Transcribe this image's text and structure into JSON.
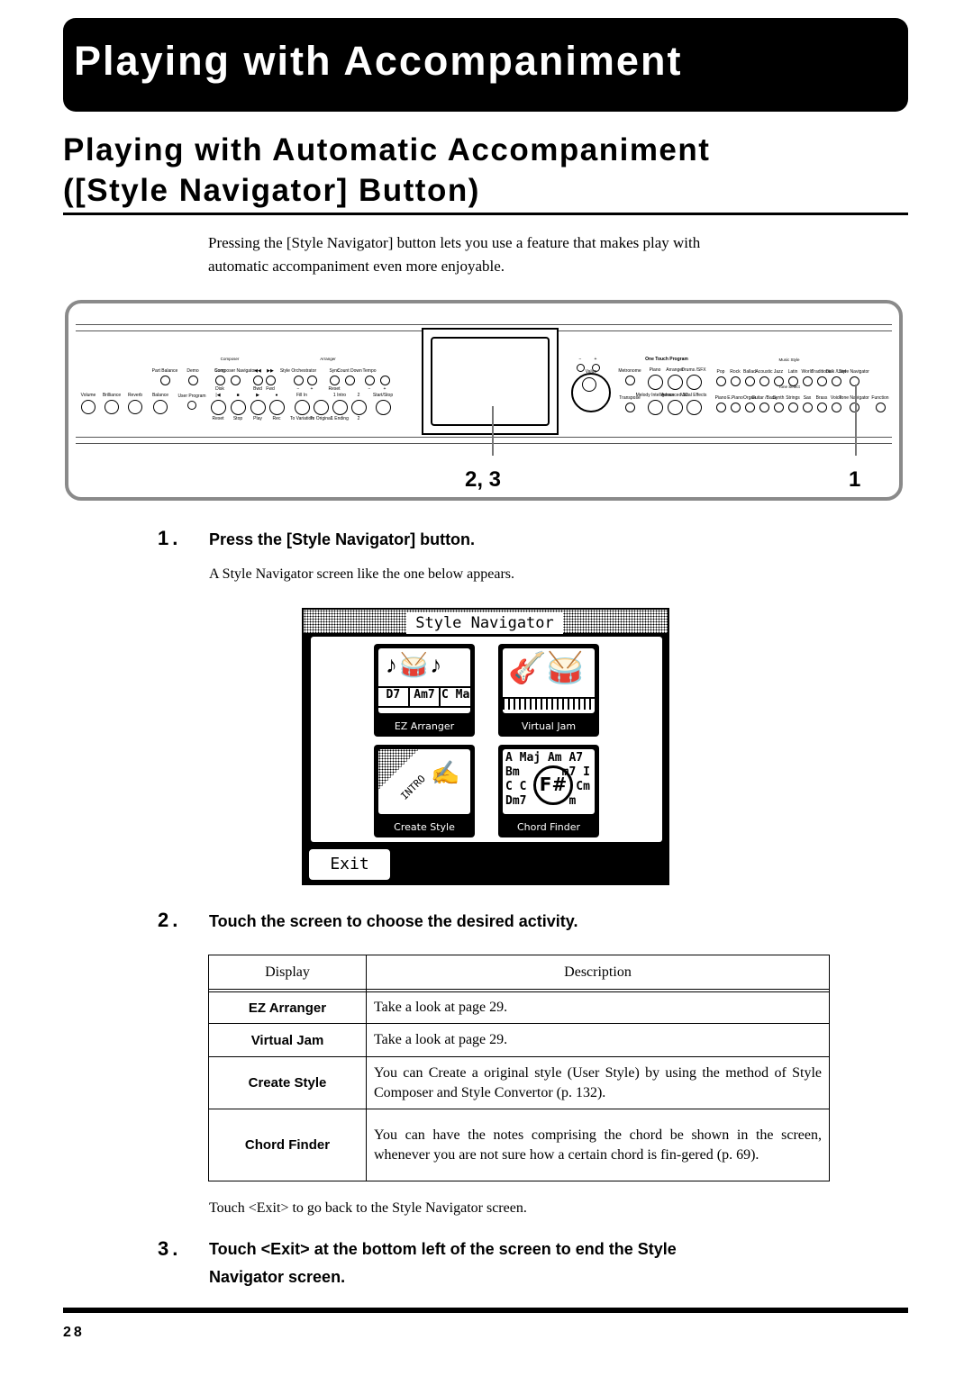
{
  "header": {
    "title": "Playing with Accompaniment"
  },
  "section": {
    "title_line1": "Playing with Automatic Accompaniment",
    "title_line2": "([Style Navigator] Button)",
    "intro_line1": "Pressing the [Style Navigator] button lets you use a feature that makes play with",
    "intro_line2": "automatic accompaniment even more enjoyable."
  },
  "panel": {
    "group_composer": "Composer",
    "group_arranger": "Arranger",
    "group_music_style": "Music Style",
    "group_tone_select": "Tone Select",
    "group_one_touch": "One Touch Program",
    "value_label": "Value",
    "buttons": [
      {
        "label": "Part Balance"
      },
      {
        "label": "Demo"
      },
      {
        "label": "Song",
        "sub": "Disk"
      },
      {
        "label": "Composer Navigator"
      },
      {
        "label": "◀◀",
        "sub": "Bwd"
      },
      {
        "label": "▶▶",
        "sub": "Fwd"
      },
      {
        "label": "Style Orchestrator",
        "sub": "−"
      },
      {
        "label": "",
        "sub": "+"
      },
      {
        "label": "Sync",
        "sub": "Reset"
      },
      {
        "label": "Count Down"
      },
      {
        "label": "Tempo",
        "sub": "−"
      },
      {
        "label": "",
        "sub": "+"
      },
      {
        "label": "Volume"
      },
      {
        "label": "Brilliance"
      },
      {
        "label": "Reverb"
      },
      {
        "label": "Balance"
      },
      {
        "label": "User Program"
      },
      {
        "label": "|◀",
        "sub": "Reset"
      },
      {
        "label": "■",
        "sub": "Stop"
      },
      {
        "label": "▶",
        "sub": "Play"
      },
      {
        "label": "●",
        "sub": "Rec"
      },
      {
        "label": "Fill In",
        "sub": "To Variation"
      },
      {
        "label": "",
        "sub": "To Original"
      },
      {
        "label": "1  Intro",
        "sub": "1  Ending"
      },
      {
        "label": "2",
        "sub": "2"
      },
      {
        "label": "Start/Stop"
      },
      {
        "label": "−"
      },
      {
        "label": "+"
      },
      {
        "label": "Metronome"
      },
      {
        "label": "Transpose"
      },
      {
        "label": "Piano"
      },
      {
        "label": "Arranger"
      },
      {
        "label": "Drums /SFX"
      },
      {
        "label": "Melody Intelligence"
      },
      {
        "label": "Advanced 3D"
      },
      {
        "label": "Vocal Effects"
      },
      {
        "label": "Pop"
      },
      {
        "label": "Rock"
      },
      {
        "label": "Ballad"
      },
      {
        "label": "Acoustic"
      },
      {
        "label": "Jazz"
      },
      {
        "label": "Latin"
      },
      {
        "label": "World"
      },
      {
        "label": "Traditional"
      },
      {
        "label": "Disk /User"
      },
      {
        "label": "Style Navigator"
      },
      {
        "label": "Piano"
      },
      {
        "label": "E.Piano"
      },
      {
        "label": "Organ"
      },
      {
        "label": "Guitar /Bass"
      },
      {
        "label": "Synth"
      },
      {
        "label": "Strings"
      },
      {
        "label": "Sax"
      },
      {
        "label": "Brass"
      },
      {
        "label": "Voice"
      },
      {
        "label": "Tone Navigator"
      },
      {
        "label": "Function"
      }
    ],
    "callout_left": "2, 3",
    "callout_right": "1"
  },
  "steps": [
    {
      "number": "1.",
      "heading": "Press the [Style Navigator] button.",
      "text": "A Style Navigator screen like the one below appears."
    },
    {
      "number": "2.",
      "heading": "Touch the screen to choose the desired activity."
    },
    {
      "number": "3.",
      "heading_line1": "Touch <Exit> at the bottom left of the screen to end the Style",
      "heading_line2": "Navigator screen."
    }
  ],
  "screen": {
    "title": "Style Navigator",
    "tiles": [
      {
        "label": "EZ Arranger",
        "chords": [
          "D7",
          "Am7",
          "C Ma"
        ]
      },
      {
        "label": "Virtual Jam"
      },
      {
        "label": "Create Style",
        "art_text": "INTRO"
      },
      {
        "label": "Chord Finder",
        "art_text": [
          "A Maj Am A7",
          "Bm      m7 I",
          "C C       Cm",
          "Dm7      m"
        ],
        "lens": "F#"
      }
    ],
    "exit_label": "Exit"
  },
  "table": {
    "headers": [
      "Display",
      "Description"
    ],
    "rows": [
      {
        "display": "EZ Arranger",
        "description": "Take a look at page 29."
      },
      {
        "display": "Virtual Jam",
        "description": "Take a look at page 29."
      },
      {
        "display": "Create Style",
        "description": "You can Create a original style (User Style) by using the method of Style Composer and Style Convertor (p. 132)."
      },
      {
        "display": "Chord Finder",
        "description": "You can have the notes comprising the chord be shown in the screen, whenever you are not sure how a certain chord is fin-gered (p. 69)."
      }
    ]
  },
  "note": "Touch <Exit> to go back to the Style Navigator screen.",
  "footer": {
    "page_number": "28"
  }
}
